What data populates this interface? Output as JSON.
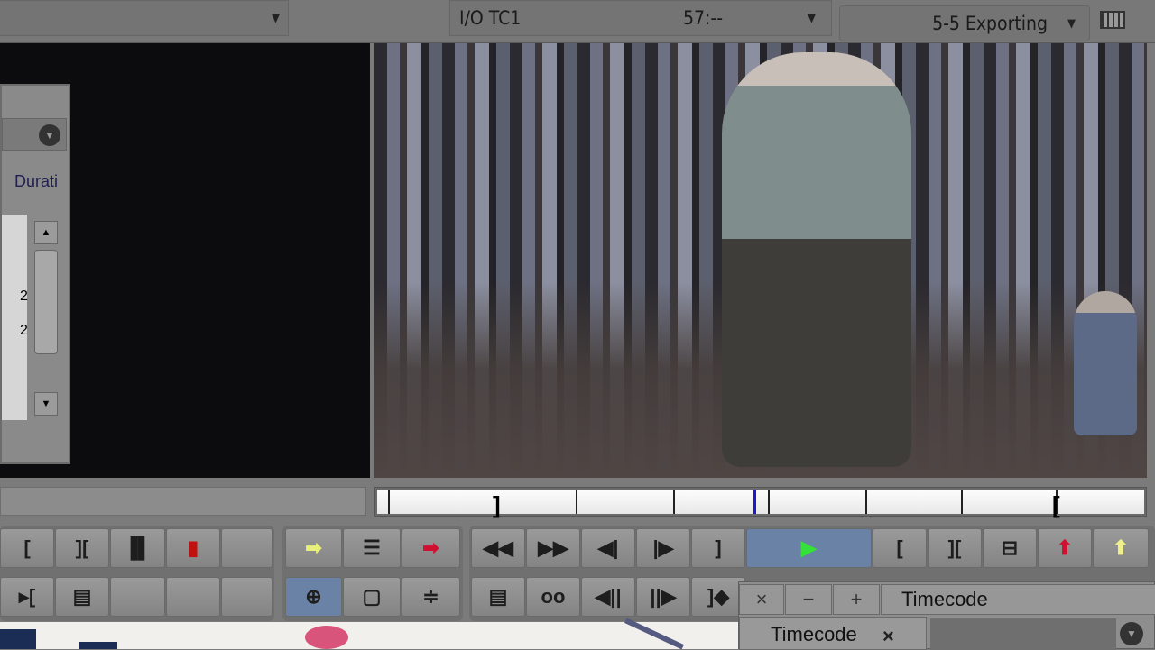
{
  "top_bar": {
    "left_field": "",
    "io_label": "I/O TC1",
    "io_value": "57:--",
    "workspace": "5-5 Exporting"
  },
  "bin": {
    "column_header": "Durati",
    "row_values": [
      "2",
      "2"
    ]
  },
  "transport_row1": [
    "mark-in",
    "mark-out",
    "mark-clip",
    "add-locator",
    "",
    "splice-in",
    "overwrite",
    "lift-red",
    "rewind",
    "fast-forward",
    "step-back",
    "step-forward",
    "mark-out",
    "play",
    "mark-in",
    "mark-in-out",
    "film",
    "lift",
    "extract"
  ],
  "popup": {
    "close": "×",
    "minus": "−",
    "plus": "+",
    "title": "Timecode",
    "tab_label": "Timecode",
    "tab_close": "×"
  },
  "colors": {
    "play": "#35e03a",
    "selected": "#6a82a6",
    "position_marker": "#1a1ad0"
  }
}
